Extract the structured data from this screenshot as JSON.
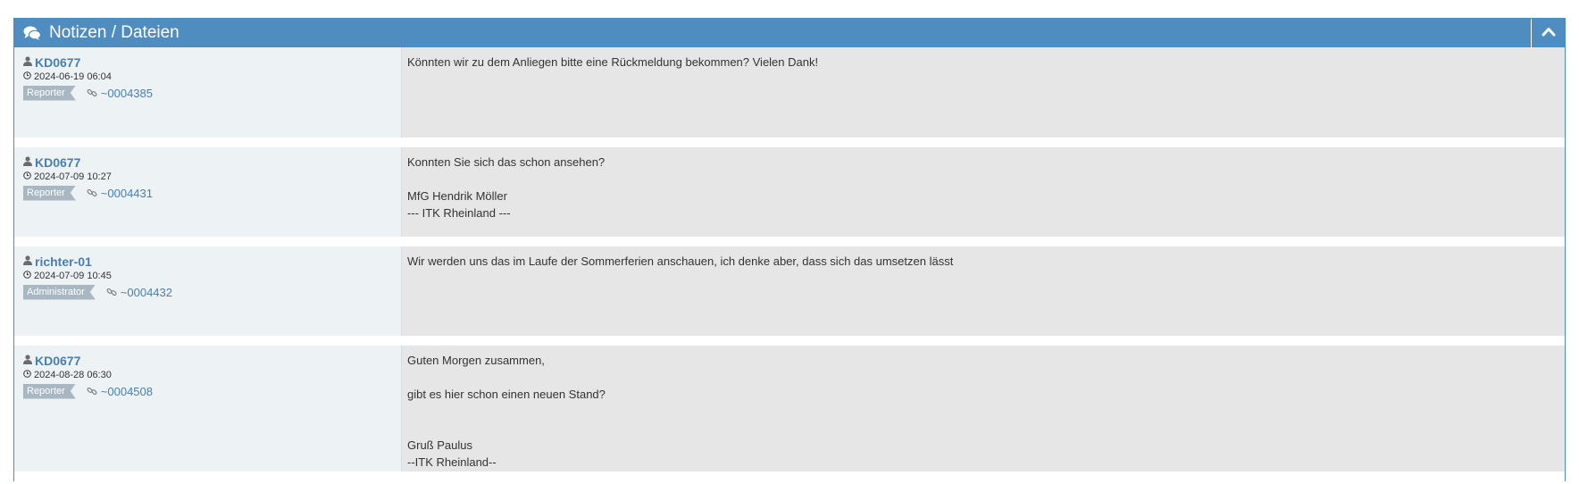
{
  "widget": {
    "title": "Notizen / Dateien",
    "header_color": "#4f8dc0",
    "icons": {
      "header": "comments-icon",
      "collapse": "chevron-up-icon"
    }
  },
  "notes": [
    {
      "author": "KD0677",
      "date": "2024-06-19 06:04",
      "role": "Reporter",
      "link": "~0004385",
      "lines": [
        "Könnten wir zu dem Anliegen bitte eine Rückmeldung bekommen? Vielen Dank!"
      ]
    },
    {
      "author": "KD0677",
      "date": "2024-07-09 10:27",
      "role": "Reporter",
      "link": "~0004431",
      "lines": [
        "Konnten Sie sich das schon ansehen?",
        "",
        "MfG Hendrik Möller",
        "--- ITK Rheinland ---"
      ]
    },
    {
      "author": "richter-01",
      "date": "2024-07-09 10:45",
      "role": "Administrator",
      "link": "~0004432",
      "lines": [
        "Wir werden uns das im Laufe der Sommerferien anschauen, ich denke aber, dass sich das umsetzen lässt"
      ]
    },
    {
      "author": "KD0677",
      "date": "2024-08-28 06:30",
      "role": "Reporter",
      "link": "~0004508",
      "lines": [
        "Guten Morgen zusammen,",
        "",
        "gibt es hier schon einen neuen Stand?",
        "",
        "",
        "Gruß Paulus",
        "--ITK Rheinland--"
      ]
    }
  ]
}
